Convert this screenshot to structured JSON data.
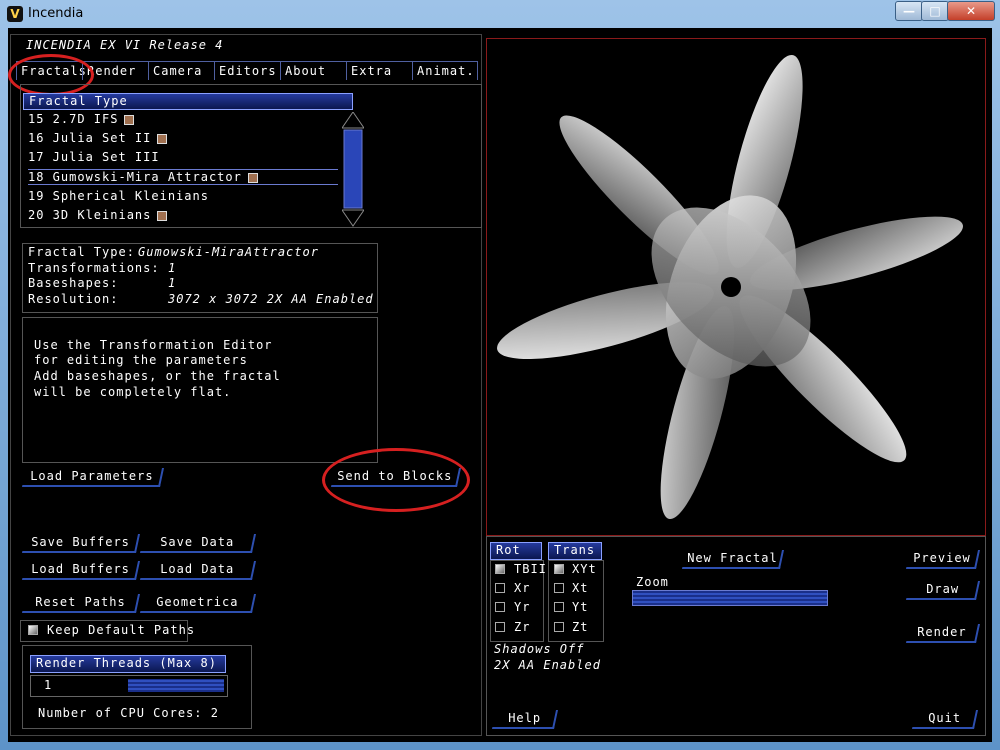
{
  "window": {
    "title": "Incendia",
    "min": "—",
    "max": "□",
    "close": "✕"
  },
  "header": {
    "title": "INCENDIA EX VI  Release 4"
  },
  "tabs": [
    "Fractals",
    "Render",
    "Camera",
    "Editors",
    "About",
    "Extra",
    "Animat."
  ],
  "fractal_list": {
    "header": "Fractal Type",
    "items": [
      {
        "label": "15 2.7D IFS",
        "swatch": true
      },
      {
        "label": "16 Julia Set II",
        "swatch": true
      },
      {
        "label": "17 Julia Set III",
        "swatch": false
      },
      {
        "label": "18 Gumowski-Mira Attractor",
        "swatch": true
      },
      {
        "label": "19 Spherical Kleinians",
        "swatch": false
      },
      {
        "label": "20 3D Kleinians",
        "swatch": true
      }
    ]
  },
  "info": {
    "type_label": "Fractal Type:",
    "type_value": "Gumowski-MiraAttractor",
    "trans_label": "Transformations:",
    "trans_value": "1",
    "base_label": "Baseshapes:",
    "base_value": "1",
    "res_label": "Resolution:",
    "res_value": "3072 x 3072  2X AA Enabled"
  },
  "help_text": [
    "Use the Transformation Editor",
    "for editing the parameters",
    "Add baseshapes, or the fractal",
    "will be completely flat."
  ],
  "buttons": {
    "load_params": "Load Parameters",
    "send_blocks": "Send to Blocks",
    "save_buffers": "Save Buffers",
    "save_data": "Save Data",
    "load_buffers": "Load Buffers",
    "load_data": "Load Data",
    "reset_paths": "Reset Paths",
    "geometrica": "Geometrica",
    "keep_paths": "Keep Default Paths",
    "new_fractal": "New Fractal",
    "preview": "Preview",
    "draw": "Draw",
    "render": "Render",
    "help": "Help",
    "quit": "Quit"
  },
  "threads": {
    "header": "Render Threads (Max 8)",
    "value": "1",
    "cores": "Number of CPU Cores: 2"
  },
  "rot": {
    "header": "Rot",
    "items": [
      "TBII",
      "Xr",
      "Yr",
      "Zr"
    ]
  },
  "trans": {
    "header": "Trans",
    "items": [
      "XYt",
      "Xt",
      "Yt",
      "Zt"
    ]
  },
  "zoom_label": "Zoom",
  "status": {
    "shadows": "Shadows Off",
    "aa": "2X AA Enabled"
  }
}
